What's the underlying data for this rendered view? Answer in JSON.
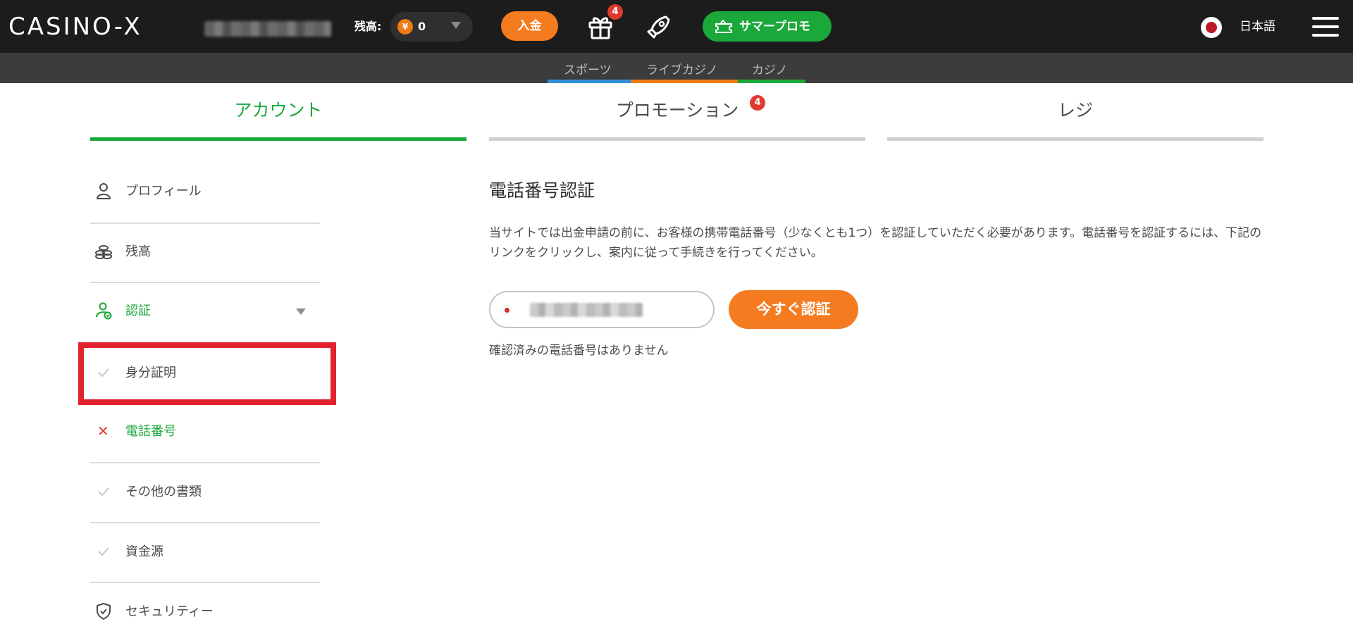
{
  "header": {
    "logo": "CASINO-X",
    "balance_label": "残高:",
    "currency_symbol": "¥",
    "balance_value": "0",
    "deposit_label": "入金",
    "gift_badge_count": "4",
    "promo_button_label": "サマープロモ",
    "language_label": "日本語"
  },
  "subnav": {
    "items": [
      {
        "label": "スポーツ",
        "color": "#2f8fd8"
      },
      {
        "label": "ライブカジノ",
        "color": "#f07a14"
      },
      {
        "label": "カジノ",
        "color": "#1aa83a"
      }
    ]
  },
  "tabs": [
    {
      "label": "アカウント",
      "active": true
    },
    {
      "label": "プロモーション",
      "badge": "4",
      "active": false
    },
    {
      "label": "レジ",
      "active": false
    }
  ],
  "sidebar": {
    "items": [
      {
        "label": "プロフィール"
      },
      {
        "label": "残高"
      },
      {
        "label": "認証"
      },
      {
        "label": "身分証明"
      },
      {
        "label": "電話番号"
      },
      {
        "label": "その他の書類"
      },
      {
        "label": "資金源"
      },
      {
        "label": "セキュリティー"
      }
    ]
  },
  "main": {
    "title": "電話番号認証",
    "description": "当サイトでは出金申請の前に、お客様の携帯電話番号（少なくとも1つ）を認証していただく必要があります。電話番号を認証するには、下記のリンクをクリックし、案内に従って手続きを行ってください。",
    "verify_button_label": "今すぐ認証",
    "no_verified_text": "確認済みの電話番号はありません"
  },
  "colors": {
    "accent_green": "#1aa83a",
    "accent_orange": "#f47b1f",
    "badge_red": "#e23a2f",
    "highlight_red": "#e0232e"
  }
}
